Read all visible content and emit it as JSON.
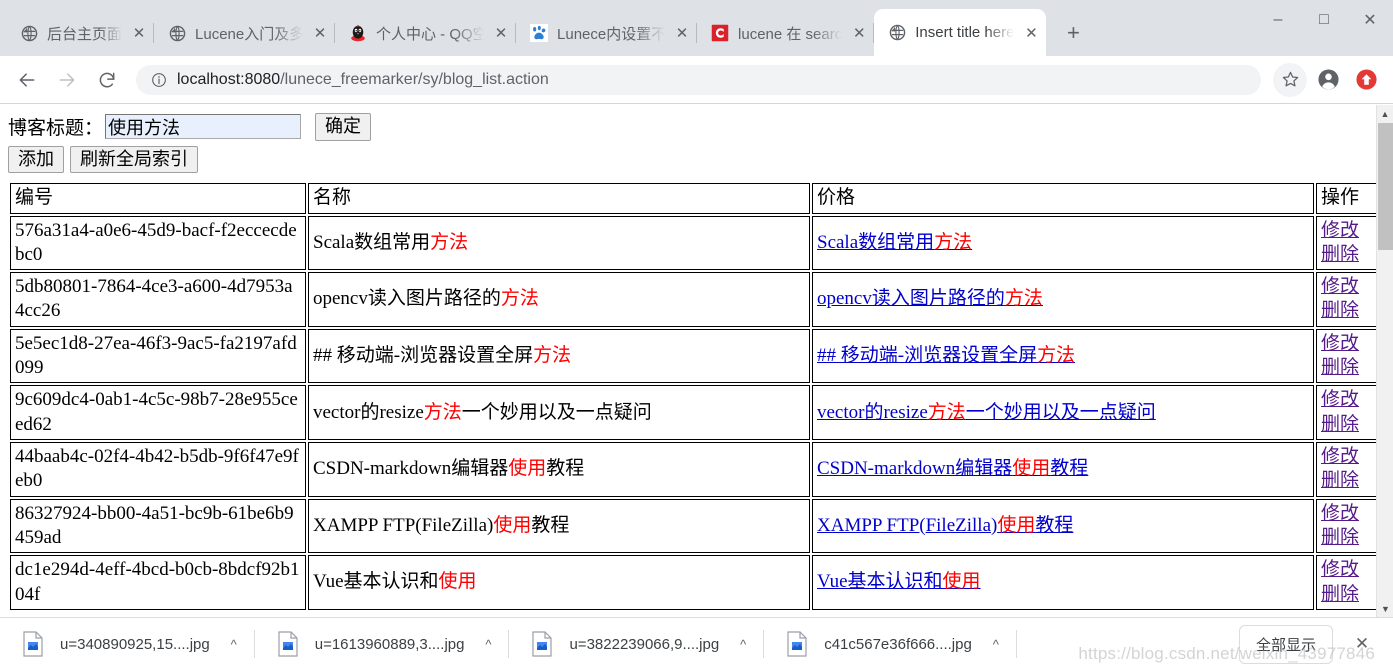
{
  "browser": {
    "tabs": [
      {
        "title": "后台主页面",
        "icon": "globe-icon",
        "active": false
      },
      {
        "title": "Lucene入门及多",
        "icon": "globe-icon",
        "active": false
      },
      {
        "title": "个人中心 - QQ空",
        "icon": "qq-penguin-icon",
        "active": false
      },
      {
        "title": "Lunece内设置不",
        "icon": "baidu-paw-icon",
        "active": false
      },
      {
        "title": "lucene 在 searc",
        "icon": "csdn-c-icon",
        "active": false
      },
      {
        "title": "Insert title here",
        "icon": "globe-icon",
        "active": true
      }
    ],
    "new_tab_label": "+",
    "window_controls": {
      "minimize": "–",
      "maximize": "□",
      "close": "✕"
    },
    "nav": {
      "back": "←",
      "forward": "→",
      "reload": "⟳"
    },
    "omnibox": {
      "info_icon": "info-circle-icon",
      "url_host": "localhost:8080",
      "url_path": "/lunece_freemarker/sy/blog_list.action",
      "full_url": "localhost:8080/lunece_freemarker/sy/blog_list.action"
    },
    "toolbar_icons": {
      "bookmark": "star-icon",
      "profile": "account-avatar-icon",
      "update": "update-arrow-icon"
    }
  },
  "page": {
    "search_label": "博客标题：",
    "search_value": "使用方法",
    "search_placeholder": "",
    "submit_label": "确定",
    "add_label": "添加",
    "refresh_index_label": "刷新全局索引",
    "table": {
      "headers": [
        "编号",
        "名称",
        "价格",
        "操作"
      ],
      "op_edit_label": "修改",
      "op_delete_label": "删除",
      "rows": [
        {
          "id": "576a31a4-a0e6-45d9-bacf-f2eccecdebc0",
          "name_pre": "Scala数组常用",
          "name_hl": "方法",
          "name_post": "",
          "price_pre": "Scala数组常用",
          "price_hl": "方法",
          "price_post": ""
        },
        {
          "id": "5db80801-7864-4ce3-a600-4d7953a4cc26",
          "name_pre": "opencv读入图片路径的",
          "name_hl": "方法",
          "name_post": "",
          "price_pre": "opencv读入图片路径的",
          "price_hl": "方法",
          "price_post": ""
        },
        {
          "id": "5e5ec1d8-27ea-46f3-9ac5-fa2197afd099",
          "name_pre": "## 移动端-浏览器设置全屏",
          "name_hl": "方法",
          "name_post": "",
          "price_pre": "## 移动端-浏览器设置全屏",
          "price_hl": "方法",
          "price_post": ""
        },
        {
          "id": "9c609dc4-0ab1-4c5c-98b7-28e955ceed62",
          "name_pre": "vector的resize",
          "name_hl": "方法",
          "name_post": "一个妙用以及一点疑问",
          "price_pre": "vector的resize",
          "price_hl": "方法",
          "price_post": "一个妙用以及一点疑问"
        },
        {
          "id": "44baab4c-02f4-4b42-b5db-9f6f47e9feb0",
          "name_pre": "CSDN-markdown编辑器",
          "name_hl": "使用",
          "name_post": "教程",
          "price_pre": "CSDN-markdown编辑器",
          "price_hl": "使用",
          "price_post": "教程"
        },
        {
          "id": "86327924-bb00-4a51-bc9b-61be6b9459ad",
          "name_pre": "XAMPP FTP(FileZilla)",
          "name_hl": "使用",
          "name_post": "教程",
          "price_pre": "XAMPP FTP(FileZilla)",
          "price_hl": "使用",
          "price_post": "教程"
        },
        {
          "id": "dc1e294d-4eff-4bcd-b0cb-8bdcf92b104f",
          "name_pre": "Vue基本认识和",
          "name_hl": "使用",
          "name_post": "",
          "price_pre": "Vue基本认识和",
          "price_hl": "使用",
          "price_post": ""
        }
      ]
    }
  },
  "downloads": {
    "items": [
      {
        "filename": "u=340890925,15....jpg"
      },
      {
        "filename": "u=1613960889,3....jpg"
      },
      {
        "filename": "u=3822239066,9....jpg"
      },
      {
        "filename": "c41c567e36f666....jpg"
      }
    ],
    "show_all_label": "全部显示",
    "close_label": "✕"
  },
  "watermark": "https://blog.csdn.net/weixin_43977846",
  "colors": {
    "chrome_bg": "#dee1e6",
    "link": "#0000cc",
    "visited_link": "#551a8b",
    "highlight": "#ff0000",
    "csdn_red": "#d8232a",
    "update_red": "#e53935"
  }
}
